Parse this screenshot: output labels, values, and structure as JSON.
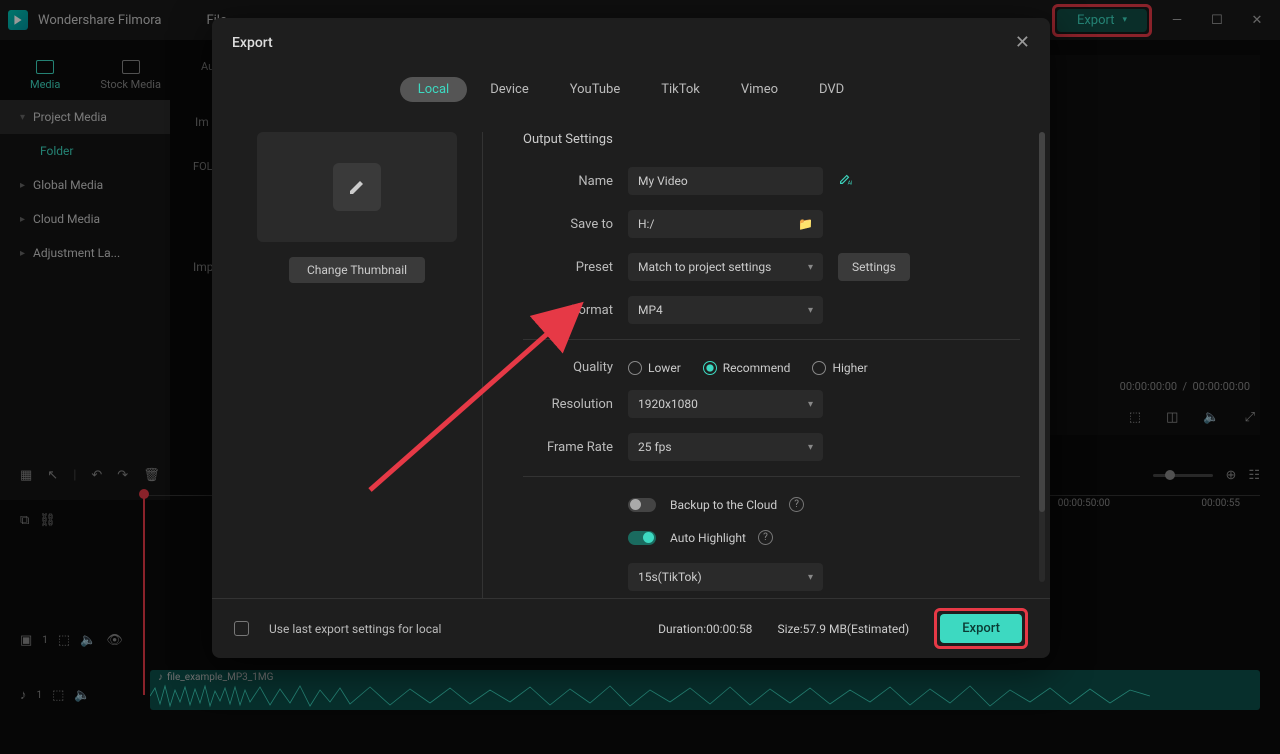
{
  "app": {
    "name": "Wondershare Filmora"
  },
  "menu": {
    "file": "File"
  },
  "topExport": {
    "label": "Export"
  },
  "bgTabs": {
    "media": "Media",
    "stock": "Stock Media",
    "audio": "Au"
  },
  "sidebar": {
    "project": "Project Media",
    "folder": "Folder",
    "global": "Global Media",
    "cloud": "Cloud Media",
    "adjust": "Adjustment La..."
  },
  "bgPanel": {
    "imp": "Im",
    "folder": "FOLD",
    "import": "Imp"
  },
  "preview": {
    "t1": "00:00:00:00",
    "t2": "00:00:00:00"
  },
  "ruler": {
    "t50": "00:00:50:00",
    "t55": "00:00:55"
  },
  "audioClip": {
    "name": "file_example_MP3_1MG"
  },
  "modal": {
    "title": "Export",
    "tabs": {
      "local": "Local",
      "device": "Device",
      "youtube": "YouTube",
      "tiktok": "TikTok",
      "vimeo": "Vimeo",
      "dvd": "DVD"
    },
    "changeThumb": "Change Thumbnail",
    "section": "Output Settings",
    "labels": {
      "name": "Name",
      "saveto": "Save to",
      "preset": "Preset",
      "format": "Format",
      "quality": "Quality",
      "resolution": "Resolution",
      "framerate": "Frame Rate"
    },
    "values": {
      "name": "My Video",
      "saveto": "H:/",
      "preset": "Match to project settings",
      "format": "MP4",
      "resolution": "1920x1080",
      "framerate": "25 fps",
      "highlight_preset": "15s(TikTok)"
    },
    "settingsBtn": "Settings",
    "quality": {
      "lower": "Lower",
      "recommend": "Recommend",
      "higher": "Higher"
    },
    "backup": "Backup to the Cloud",
    "autohighlight": "Auto Highlight",
    "footer": {
      "useLast": "Use last export settings for local",
      "duration": "Duration:00:00:58",
      "size": "Size:57.9 MB(Estimated)",
      "export": "Export"
    }
  }
}
